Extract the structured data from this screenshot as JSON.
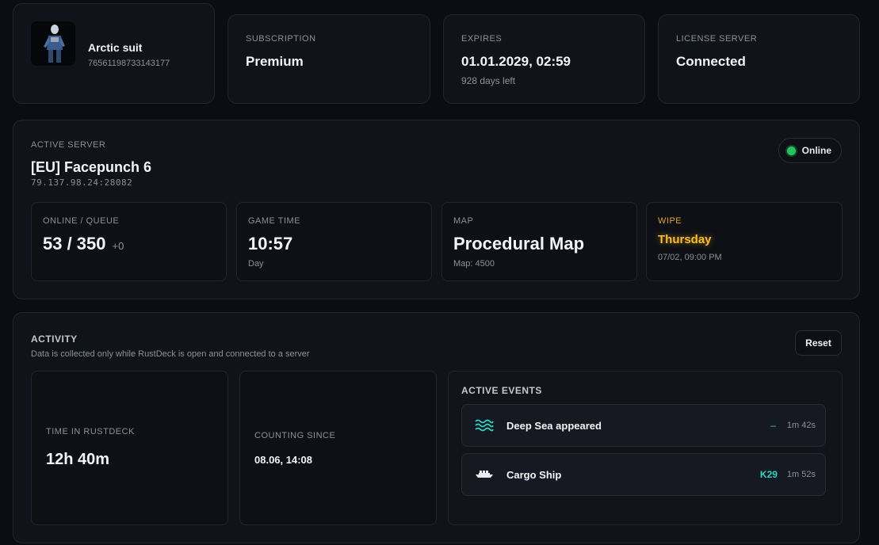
{
  "profile": {
    "name": "Arctic suit",
    "steam_id": "76561198733143177"
  },
  "subscription": {
    "label": "SUBSCRIPTION",
    "value": "Premium"
  },
  "expires": {
    "label": "EXPIRES",
    "value": "01.01.2029, 02:59",
    "sub": "928 days left"
  },
  "license": {
    "label": "LICENSE SERVER",
    "value": "Connected"
  },
  "server": {
    "label": "ACTIVE SERVER",
    "name": "[EU] Facepunch 6",
    "address": "79.137.98.24:28082",
    "status": "Online",
    "status_color": "#22c55e",
    "stats": {
      "online": {
        "label": "ONLINE / QUEUE",
        "value": "53 / 350",
        "queue": "+0"
      },
      "time": {
        "label": "GAME TIME",
        "value": "10:57",
        "sub": "Day"
      },
      "map": {
        "label": "MAP",
        "value": "Procedural Map",
        "sub": "Map: 4500"
      },
      "wipe": {
        "label": "WIPE",
        "value": "Thursday",
        "sub": "07/02, 09:00 PM",
        "accent": "#fbbf24"
      }
    }
  },
  "activity": {
    "label": "ACTIVITY",
    "note": "Data is collected only while RustDeck is open and connected to a server",
    "reset_label": "Reset",
    "time_in": {
      "label": "TIME IN RUSTDECK",
      "value": "12h 40m"
    },
    "counting": {
      "label": "COUNTING SINCE",
      "value": "08.06, 14:08"
    },
    "events": {
      "label": "ACTIVE EVENTS",
      "items": [
        {
          "icon": "waves-icon",
          "name": "Deep Sea appeared",
          "grid": "–",
          "time": "1m 42s"
        },
        {
          "icon": "ship-icon",
          "name": "Cargo Ship",
          "grid": "K29",
          "time": "1m 52s"
        }
      ]
    }
  },
  "colors": {
    "accent_teal": "#2dd4bf",
    "accent_yellow": "#fbbf24",
    "online_green": "#22c55e"
  }
}
